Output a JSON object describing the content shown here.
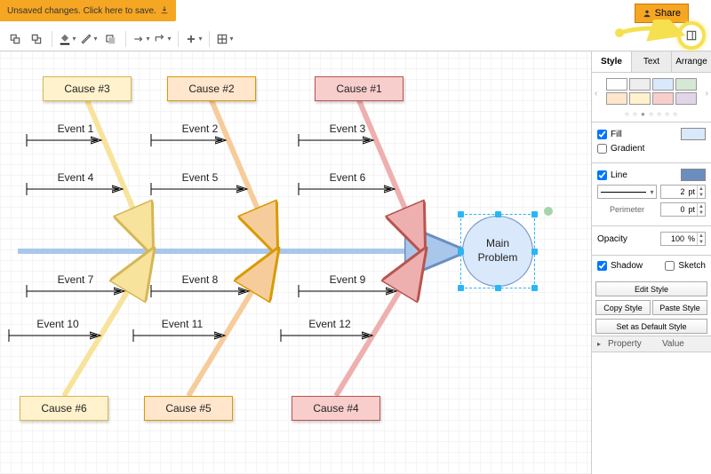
{
  "topbar": {
    "unsaved_message": "Unsaved changes. Click here to save.",
    "share_label": "Share"
  },
  "sidepanel": {
    "tabs": {
      "style": "Style",
      "text": "Text",
      "arrange": "Arrange"
    },
    "swatches": [
      "#ffffff",
      "#eeeeee",
      "#dae8fc",
      "#d5e8d4",
      "#ffe6cc",
      "#fff2cc",
      "#f8cecc",
      "#e1d5e7"
    ],
    "fill": {
      "label": "Fill",
      "checked": true,
      "color": "#dae8fc"
    },
    "gradient": {
      "label": "Gradient",
      "checked": false
    },
    "line": {
      "label": "Line",
      "checked": true,
      "color": "#6c8ebf",
      "width": "2",
      "width_unit": "pt"
    },
    "perimeter": {
      "label": "Perimeter",
      "value": "0",
      "unit": "pt"
    },
    "opacity": {
      "label": "Opacity",
      "value": "100",
      "unit": "%"
    },
    "shadow": {
      "label": "Shadow",
      "checked": true
    },
    "sketch": {
      "label": "Sketch",
      "checked": false
    },
    "buttons": {
      "edit": "Edit Style",
      "copy": "Copy Style",
      "paste": "Paste Style",
      "default": "Set as Default Style"
    },
    "prop": {
      "col1": "Property",
      "col2": "Value"
    }
  },
  "diagram": {
    "main_problem": "Main\nProblem",
    "causes": {
      "c1": "Cause #1",
      "c2": "Cause #2",
      "c3": "Cause #3",
      "c4": "Cause #4",
      "c5": "Cause #5",
      "c6": "Cause #6"
    },
    "events": {
      "e1": "Event 1",
      "e2": "Event 2",
      "e3": "Event 3",
      "e4": "Event 4",
      "e5": "Event 5",
      "e6": "Event 6",
      "e7": "Event 7",
      "e8": "Event 8",
      "e9": "Event 9",
      "e10": "Event 10",
      "e11": "Event 11",
      "e12": "Event 12"
    }
  }
}
